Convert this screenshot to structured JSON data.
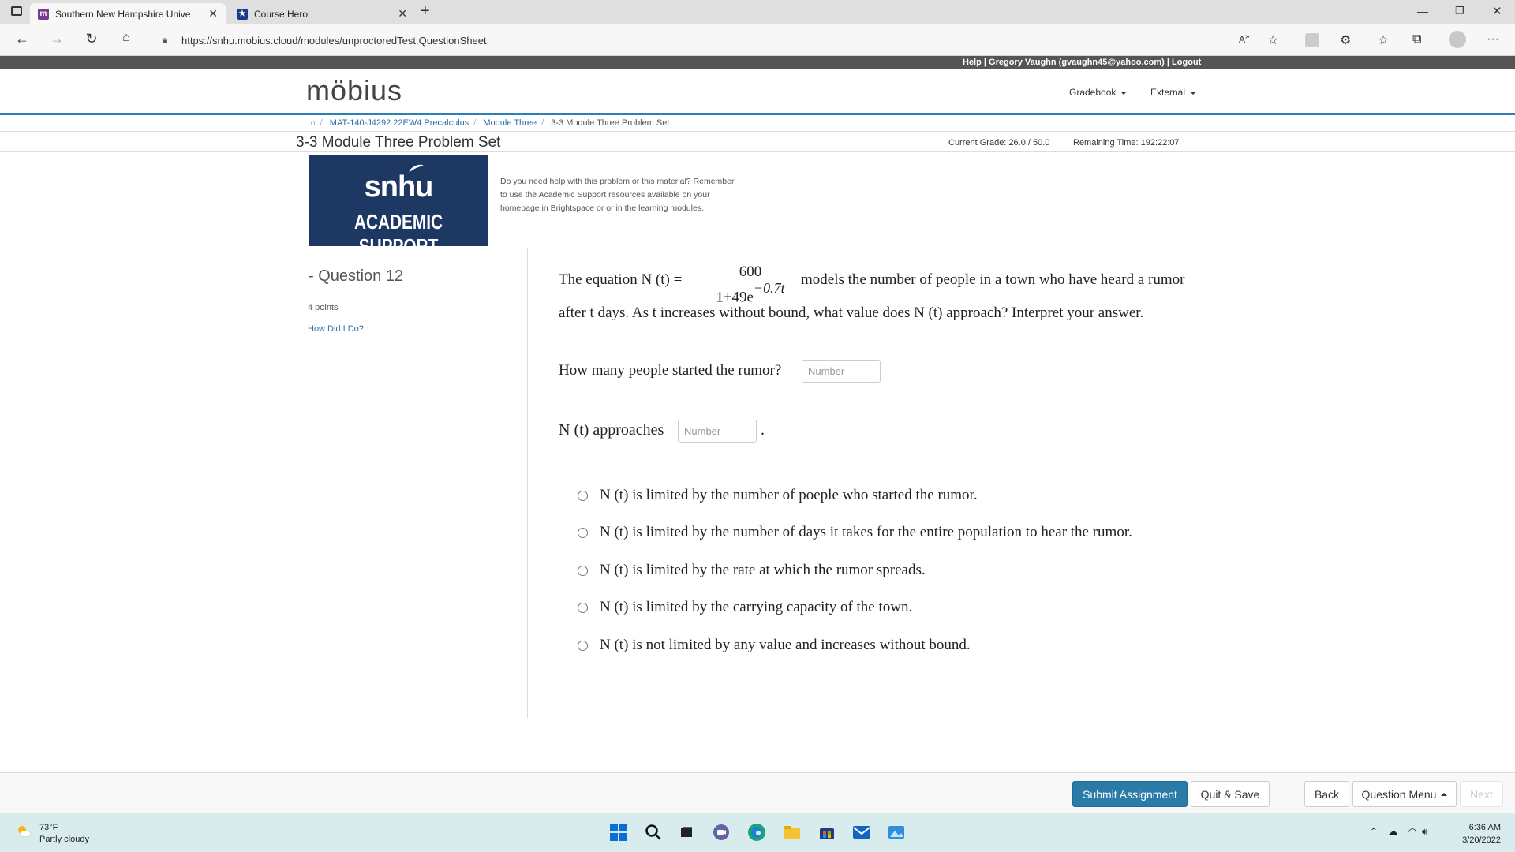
{
  "browser": {
    "tabs": [
      {
        "title": "Southern New Hampshire Unive",
        "active": true,
        "favicon": "mobius-icon"
      },
      {
        "title": "Course Hero",
        "active": false,
        "favicon": "coursehero-icon"
      }
    ],
    "url": "https://snhu.mobius.cloud/modules/unproctoredTest.QuestionSheet"
  },
  "userbar": {
    "links": "Help | Gregory Vaughn (gvaughn45@yahoo.com) | Logout"
  },
  "header": {
    "logo": "möbius",
    "menus": [
      "Gradebook",
      "External"
    ]
  },
  "breadcrumb": {
    "items": [
      "MAT-140-J4292 22EW4 Precalculus",
      "Module Three",
      "3-3 Module Three Problem Set"
    ]
  },
  "page": {
    "title": "3-3 Module Three Problem Set",
    "current_grade": "Current Grade: 26.0 / 50.0",
    "remaining_time": "Remaining Time:  192:22:07"
  },
  "banner": {
    "line1": "snhu",
    "line2": "ACADEMIC SUPPORT",
    "help_text": "Do you need help with this problem or this material? Remember to use the Academic Support resources available on your homepage in Brightspace or or in the learning modules."
  },
  "question": {
    "title": "- Question 12",
    "points": "4 points",
    "how_did_i_do": "How Did I Do?",
    "stem_prefix": "The equation N (t) =",
    "fraction_numerator": "600",
    "fraction_denominator": "1+49e",
    "fraction_exponent": "−0.7t",
    "stem_suffix": "models the number of people in a town who have heard a rumor",
    "stem_line2": "after t days. As t increases without bound, what value does N (t) approach? Interpret your answer.",
    "prompt1": "How many people started the rumor?",
    "prompt2": "N (t) approaches",
    "input_placeholder": "Number",
    "dot": ".",
    "options": [
      "N (t) is limited by the number of poeple who started the rumor.",
      "N (t) is limited by the number of days it takes for the entire population to hear the rumor.",
      "N (t) is limited by the rate at which the rumor spreads.",
      "N (t) is limited by the carrying capacity of the town.",
      "N (t) is not limited by any value and increases without bound."
    ]
  },
  "actions": {
    "submit": "Submit Assignment",
    "quit_save": "Quit & Save",
    "back": "Back",
    "question_menu": "Question Menu",
    "next": "Next"
  },
  "taskbar": {
    "temp": "73°F",
    "condition": "Partly cloudy",
    "time": "6:36 AM",
    "date": "3/20/2022"
  },
  "colors": {
    "accent": "#2b7ba8",
    "banner": "#1e3864",
    "userbar": "#555555"
  }
}
